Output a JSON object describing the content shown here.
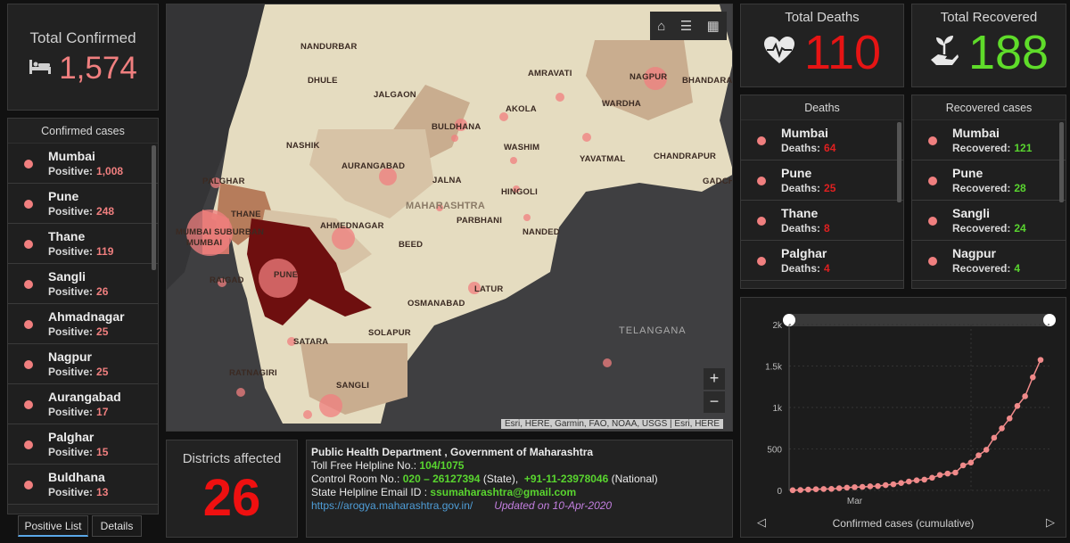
{
  "total_confirmed": {
    "title": "Total Confirmed",
    "value": "1,574",
    "icon": "bed-icon"
  },
  "total_deaths": {
    "title": "Total Deaths",
    "value": "110",
    "icon": "heart-pulse-icon"
  },
  "total_recovered": {
    "title": "Total Recovered",
    "value": "188",
    "icon": "hand-plant-icon"
  },
  "confirmed_list": {
    "header": "Confirmed cases",
    "sub_label": "Positive:",
    "items": [
      {
        "name": "Mumbai",
        "value": "1,008"
      },
      {
        "name": "Pune",
        "value": "248"
      },
      {
        "name": "Thane",
        "value": "119"
      },
      {
        "name": "Sangli",
        "value": "26"
      },
      {
        "name": "Ahmadnagar",
        "value": "25"
      },
      {
        "name": "Nagpur",
        "value": "25"
      },
      {
        "name": "Aurangabad",
        "value": "17"
      },
      {
        "name": "Palghar",
        "value": "15"
      },
      {
        "name": "Buldhana",
        "value": "13"
      }
    ]
  },
  "deaths_list": {
    "header": "Deaths",
    "sub_label": "Deaths:",
    "items": [
      {
        "name": "Mumbai",
        "value": "64"
      },
      {
        "name": "Pune",
        "value": "25"
      },
      {
        "name": "Thane",
        "value": "8"
      },
      {
        "name": "Palghar",
        "value": "4"
      }
    ]
  },
  "recovered_list": {
    "header": "Recovered cases",
    "sub_label": "Recovered:",
    "items": [
      {
        "name": "Mumbai",
        "value": "121"
      },
      {
        "name": "Pune",
        "value": "28"
      },
      {
        "name": "Sangli",
        "value": "24"
      },
      {
        "name": "Nagpur",
        "value": "4"
      }
    ]
  },
  "tabs": {
    "positive": "Positive List",
    "details": "Details"
  },
  "map": {
    "labels": [
      "NANDURBAR",
      "DHULE",
      "JALGAON",
      "AMRAVATI",
      "NAGPUR",
      "BHANDARA",
      "AKOLA",
      "WARDHA",
      "BULDHANA",
      "NASHIK",
      "WASHIM",
      "YAVATMAL",
      "CHANDRAPUR",
      "PALGHAR",
      "AURANGABAD",
      "JALNA",
      "HINGOLI",
      "GADCH",
      "THANE",
      "MUMBAI SUBURBAN",
      "MUMBAI",
      "AHMEDNAGAR",
      "MAHARASHTRA",
      "PARBHANI",
      "NANDED",
      "BEED",
      "PUNE",
      "RAIGAD",
      "LATUR",
      "OSMANABAD",
      "SATARA",
      "SOLAPUR",
      "RATNAGIRI",
      "SANGLI"
    ],
    "telangana": "TELANGANA",
    "attribution": "Esri, HERE, Garmin, FAO, NOAA, USGS | Esri, HERE",
    "toolbar_icons": [
      "home-icon",
      "list-icon",
      "qr-icon"
    ],
    "zoom_in": "+",
    "zoom_out": "−"
  },
  "districts": {
    "title": "Districts affected",
    "value": "26"
  },
  "info": {
    "line1": "Public Health Department , Government of Maharashtra",
    "tollfree_label": "Toll Free Helpline No.:",
    "tollfree": "104/1075",
    "control_label": "Control Room No.:",
    "control_state": "020 – 26127394",
    "state_tag": "(State),",
    "control_national": "+91-11-23978046",
    "national_tag": "(National)",
    "email_label": "State Helpline Email ID :",
    "email": "ssumaharashtra@gmail.com",
    "url": "https://arogya.maharashtra.gov.in/",
    "updated": "Updated on 10-Apr-2020"
  },
  "chart_data": {
    "type": "line",
    "title": "",
    "xlabel": "Confirmed cases (cumulative)",
    "ylabel": "",
    "x_tick_labels": [
      "Mar"
    ],
    "y_tick_labels": [
      "0",
      "500",
      "1k",
      "1.5k",
      "2k"
    ],
    "ylim": [
      0,
      2000
    ],
    "grid": true,
    "series": [
      {
        "color": "#f08a8a",
        "values": [
          2,
          5,
          10,
          14,
          17,
          18,
          26,
          33,
          39,
          42,
          49,
          52,
          64,
          74,
          89,
          107,
          122,
          130,
          153,
          186,
          203,
          215,
          302,
          335,
          423,
          490,
          635,
          748,
          868,
          1018,
          1135,
          1364,
          1574
        ]
      }
    ],
    "series_label_color": "#f08a8a"
  },
  "colors": {
    "accent_red": "#e61414",
    "confirmed": "#f07f7f",
    "recovered": "#5fdc2a",
    "link": "#4f9ed8"
  }
}
